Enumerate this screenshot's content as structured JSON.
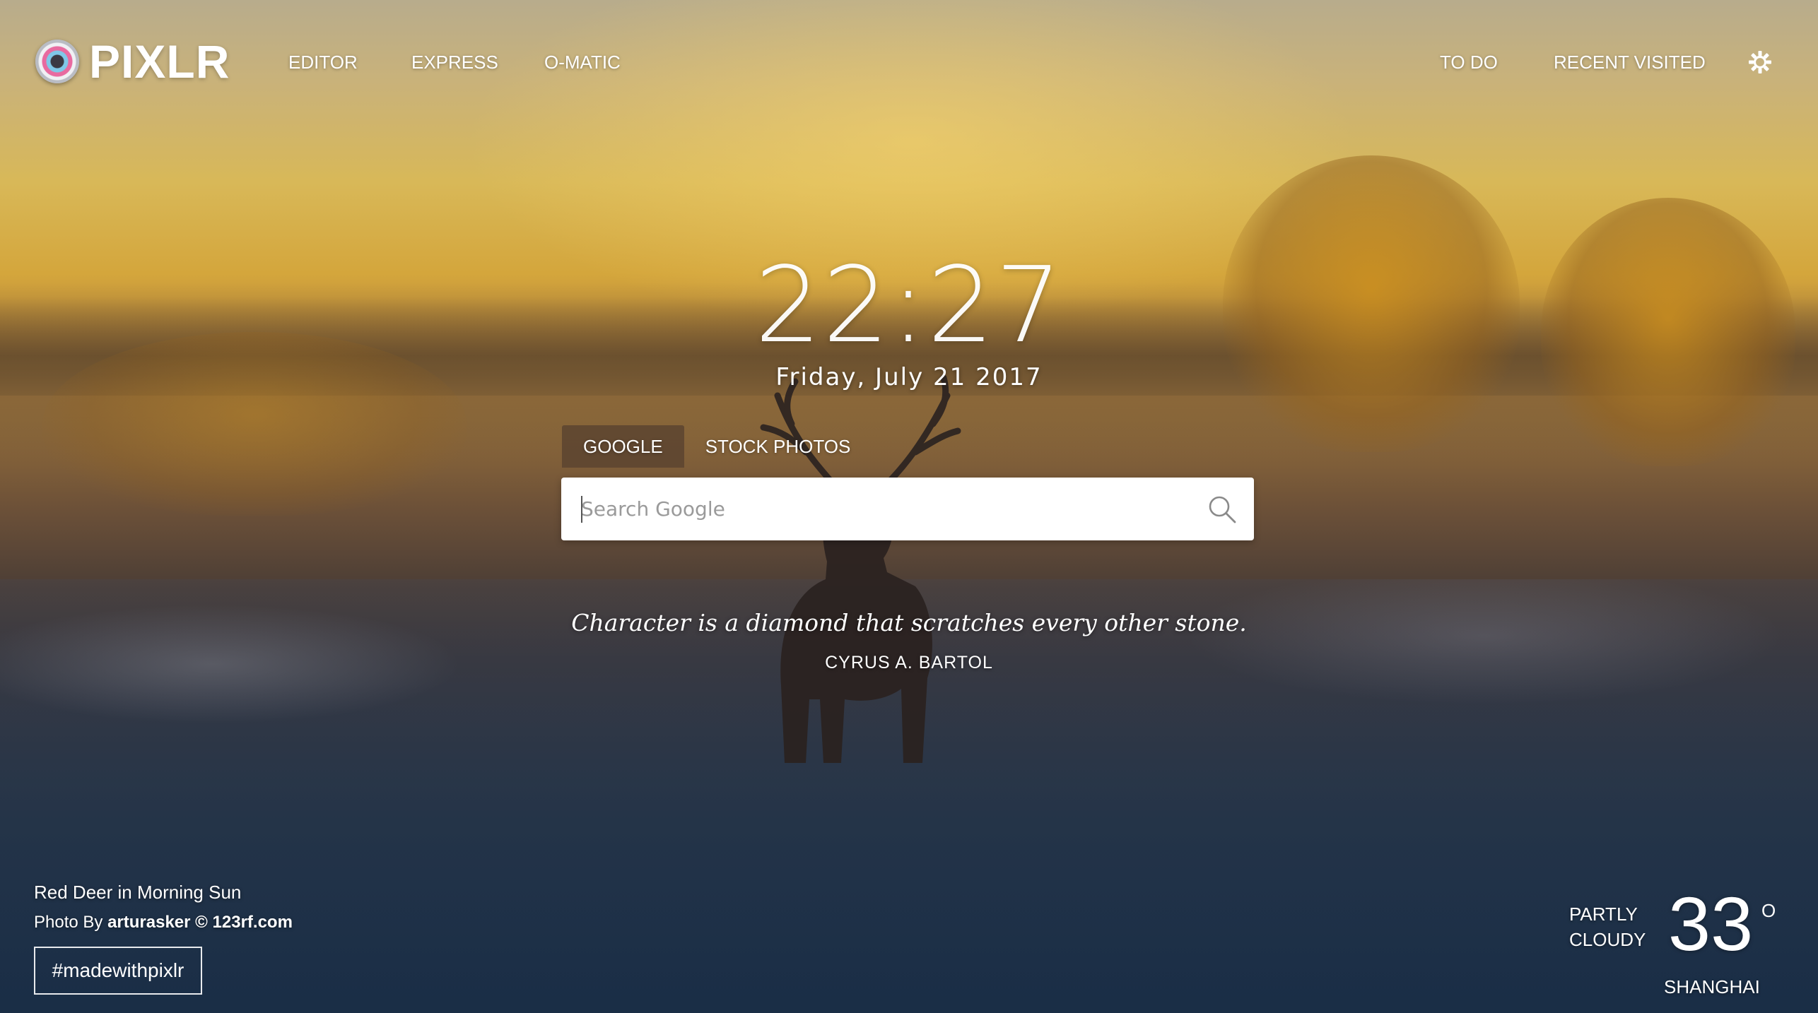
{
  "brand": {
    "name": "PIXLR"
  },
  "nav": {
    "left": [
      {
        "label": "EDITOR"
      },
      {
        "label": "EXPRESS"
      },
      {
        "label": "O-MATIC"
      }
    ],
    "right": [
      {
        "label": "TO DO"
      },
      {
        "label": "RECENT VISITED"
      }
    ],
    "settings_icon": "gear-icon"
  },
  "clock": {
    "time": "22:27",
    "date": "Friday, July 21 2017"
  },
  "search": {
    "tabs": [
      {
        "label": "GOOGLE",
        "active": true
      },
      {
        "label": "STOCK PHOTOS",
        "active": false
      }
    ],
    "placeholder": "Search Google",
    "value": "",
    "icon": "search-icon"
  },
  "quote": {
    "text": "Character is a diamond that scratches every other stone.",
    "author": "CYRUS A. BARTOL"
  },
  "photo": {
    "title": "Red Deer in Morning Sun",
    "credit_prefix": "Photo By",
    "photographer": "arturasker",
    "credit_source": "© 123rf.com"
  },
  "hashtag": {
    "label": "#madewithpixlr"
  },
  "weather": {
    "condition_line1": "PARTLY",
    "condition_line2": "CLOUDY",
    "temperature": "33",
    "unit_symbol": "O",
    "city": "SHANGHAI"
  },
  "colors": {
    "sky_top": "#b8ac8c",
    "sky_glow": "#d8b858",
    "ground": "#1c3048",
    "active_tab": "#5c4430",
    "text": "#ffffff"
  }
}
